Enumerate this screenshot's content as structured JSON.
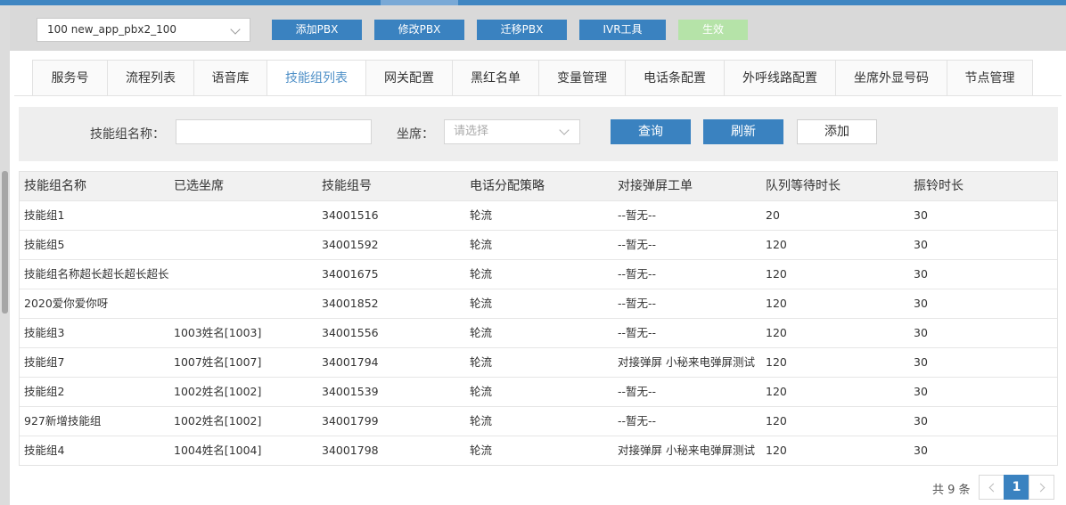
{
  "pbx_select": {
    "value": "100 new_app_pbx2_100"
  },
  "toolbar": {
    "add_pbx": "添加PBX",
    "edit_pbx": "修改PBX",
    "migrate_pbx": "迁移PBX",
    "ivr_tool": "IVR工具",
    "apply": "生效"
  },
  "tabs": [
    "服务号",
    "流程列表",
    "语音库",
    "技能组列表",
    "网关配置",
    "黑红名单",
    "变量管理",
    "电话条配置",
    "外呼线路配置",
    "坐席外显号码",
    "节点管理"
  ],
  "active_tab": "技能组列表",
  "filter": {
    "name_label": "技能组名称：",
    "name_value": "",
    "agent_label": "坐席：",
    "agent_placeholder": "请选择",
    "query": "查询",
    "refresh": "刷新",
    "add": "添加"
  },
  "table": {
    "headers": [
      "技能组名称",
      "已选坐席",
      "技能组号",
      "电话分配策略",
      "对接弹屏工单",
      "队列等待时长",
      "振铃时长"
    ],
    "rows": [
      [
        "技能组1",
        "",
        "34001516",
        "轮流",
        "--暂无--",
        "20",
        "30"
      ],
      [
        "技能组5",
        "",
        "34001592",
        "轮流",
        "--暂无--",
        "120",
        "30"
      ],
      [
        "技能组名称超长超长超长超长",
        "",
        "34001675",
        "轮流",
        "--暂无--",
        "120",
        "30"
      ],
      [
        "2020爱你爱你呀",
        "",
        "34001852",
        "轮流",
        "--暂无--",
        "120",
        "30"
      ],
      [
        "技能组3",
        "1003姓名[1003]",
        "34001556",
        "轮流",
        "--暂无--",
        "120",
        "30"
      ],
      [
        "技能组7",
        "1007姓名[1007]",
        "34001794",
        "轮流",
        "对接弹屏 小秘来电弹屏测试",
        "120",
        "30"
      ],
      [
        "技能组2",
        "1002姓名[1002]",
        "34001539",
        "轮流",
        "--暂无--",
        "120",
        "30"
      ],
      [
        "927新增技能组",
        "1002姓名[1002]",
        "34001799",
        "轮流",
        "--暂无--",
        "120",
        "30"
      ],
      [
        "技能组4",
        "1004姓名[1004]",
        "34001798",
        "轮流",
        "对接弹屏 小秘来电弹屏测试",
        "120",
        "30"
      ]
    ]
  },
  "pager": {
    "total": "共 9 条",
    "current": "1"
  },
  "colors": {
    "primary": "#3a82c0",
    "link": "#3d7fb7",
    "apply_disabled": "#b5e3a8"
  }
}
